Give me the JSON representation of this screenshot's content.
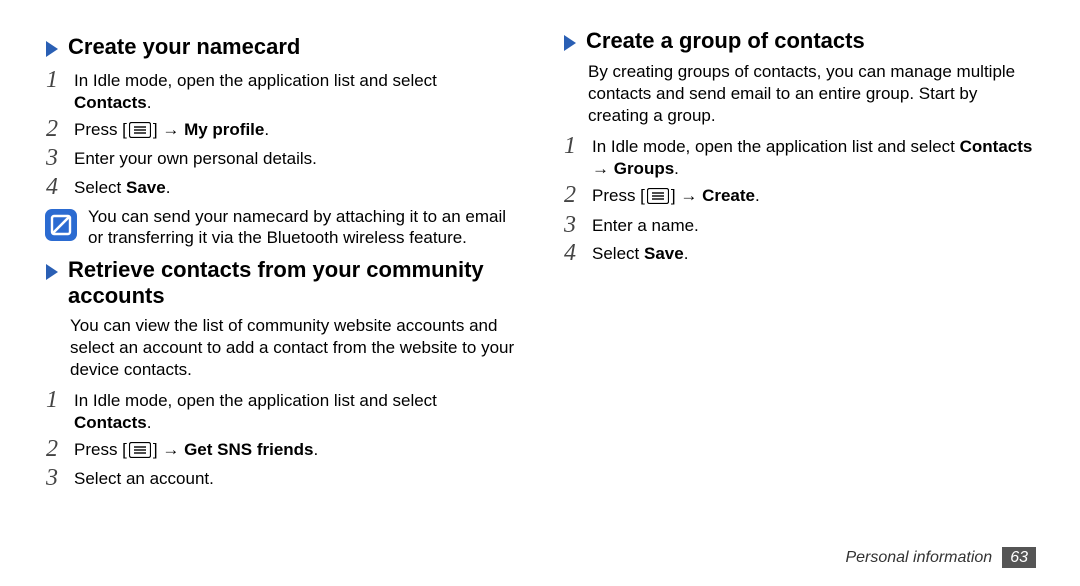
{
  "sections": {
    "namecard": {
      "title": "Create your namecard",
      "steps": [
        {
          "pre": "In Idle mode, open the application list and select ",
          "bold": "Contacts",
          "post": "."
        },
        {
          "pre": "Press [",
          "icon": "menu",
          "mid": "] → ",
          "bold": "My profile",
          "post": "."
        },
        {
          "pre": "Enter your own personal details."
        },
        {
          "pre": "Select ",
          "bold": "Save",
          "post": "."
        }
      ],
      "note": "You can send your namecard by attaching it to an email or transferring it via the Bluetooth wireless feature."
    },
    "retrieve": {
      "title": "Retrieve contacts from your community accounts",
      "intro": "You can view the list of community website accounts and select an account to add a contact from the website to your device contacts.",
      "steps": [
        {
          "pre": "In Idle mode, open the application list and select ",
          "bold": "Contacts",
          "post": "."
        },
        {
          "pre": "Press [",
          "icon": "menu",
          "mid": "] → ",
          "bold": "Get SNS friends",
          "post": "."
        },
        {
          "pre": "Select an account."
        }
      ]
    },
    "group": {
      "title": "Create a group of contacts",
      "intro": "By creating groups of contacts, you can manage multiple contacts and send email to an entire group. Start by creating a group.",
      "steps": [
        {
          "pre": "In Idle mode, open the application list and select ",
          "bold": "Contacts → Groups",
          "post": "."
        },
        {
          "pre": "Press [",
          "icon": "menu",
          "mid": "] → ",
          "bold": "Create",
          "post": "."
        },
        {
          "pre": "Enter a name."
        },
        {
          "pre": "Select ",
          "bold": "Save",
          "post": "."
        }
      ]
    }
  },
  "footer": {
    "section": "Personal information",
    "page": "63"
  }
}
